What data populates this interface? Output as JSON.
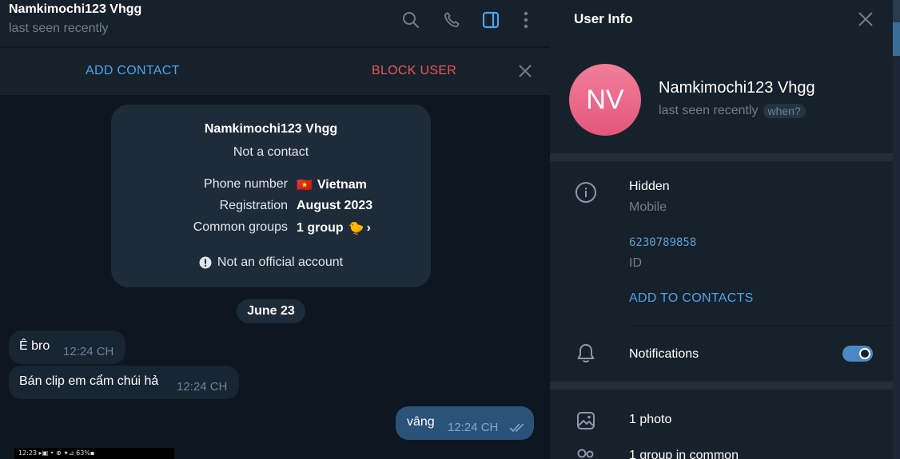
{
  "chat": {
    "name": "Namkimochi123 Vhgg",
    "status": "last seen recently",
    "header_icons": [
      "search-icon",
      "phone-icon",
      "sidebar-toggle-icon",
      "more-vertical-icon"
    ]
  },
  "action_bar": {
    "add_contact": "ADD CONTACT",
    "block_user": "BLOCK USER"
  },
  "card": {
    "name": "Namkimochi123 Vhgg",
    "subtitle": "Not a contact",
    "rows": [
      {
        "label": "Phone number",
        "value": "Vietnam",
        "icon": "🇻🇳"
      },
      {
        "label": "Registration",
        "value": "August 2023"
      },
      {
        "label": "Common groups",
        "value": "1 group",
        "icon": "🐤",
        "chevron": "›"
      }
    ],
    "official": "Not an official account"
  },
  "date_label": "June 23",
  "messages": [
    {
      "direction": "in",
      "text": "Ê bro",
      "time": "12:24 CH"
    },
    {
      "direction": "in",
      "text": "Bán clip em cẩm chúi hả",
      "time": "12:24 CH"
    },
    {
      "direction": "out",
      "text": "vâng",
      "time": "12:24 CH",
      "read": true
    }
  ],
  "thumbnail_status": "12:23 ▸▣ •              ⊕ ✦⊿ 63%▪",
  "info": {
    "title": "User Info",
    "avatar_initials": "NV",
    "name": "Namkimochi123 Vhgg",
    "status": "last seen recently",
    "when": "when?",
    "phone": "Hidden",
    "phone_label": "Mobile",
    "id": "6230789858",
    "id_label": "ID",
    "add_to_contacts": "ADD TO CONTACTS",
    "notifications": "Notifications",
    "notifications_on": true,
    "photos": "1 photo",
    "groups": "1 group in common"
  },
  "colors": {
    "accent": "#4fa3e8",
    "danger": "#e8575c",
    "avatar": "#e4567c",
    "bubble_out": "#2b5278",
    "bubble_in": "#182533"
  }
}
